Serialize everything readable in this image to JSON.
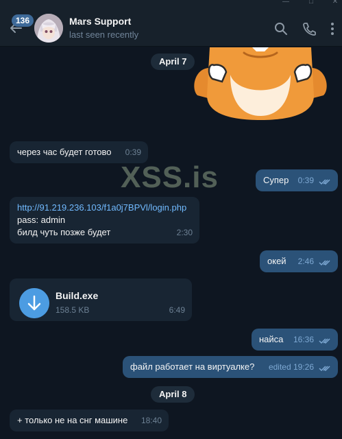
{
  "header": {
    "unread_count": "136",
    "chat_name": "Mars Support",
    "chat_status": "last seen recently",
    "icons": [
      "back-arrow-icon",
      "search-icon",
      "phone-icon",
      "more-vertical-icon"
    ]
  },
  "watermark": "XSS.is",
  "dates": [
    "April 7",
    "April 8"
  ],
  "messages": [
    {
      "dir": "in",
      "text": "через час будет готово",
      "time": "0:39"
    },
    {
      "dir": "out",
      "text": "Супер",
      "time": "0:39"
    },
    {
      "dir": "in",
      "link": "http://91.219.236.103/f1a0j7BPVl/login.php",
      "line2": "pass: admin",
      "line3": "билд чуть позже будет",
      "time": "2:30"
    },
    {
      "dir": "out",
      "text": "окей",
      "time": "2:46"
    },
    {
      "dir": "in",
      "file_name": "Build.exe",
      "file_size": "158.5 KB",
      "time": "6:49"
    },
    {
      "dir": "out",
      "text": "найса",
      "time": "16:36"
    },
    {
      "dir": "out",
      "text": "файл работает на виртуалке?",
      "time": "edited 19:26"
    },
    {
      "dir": "in",
      "text": "+ только не на снг машине",
      "time": "18:40"
    }
  ],
  "colors": {
    "background": "#0e1621",
    "incoming": "#182533",
    "outgoing": "#2b5278",
    "accent": "#4c9ce2",
    "link": "#71baff"
  }
}
